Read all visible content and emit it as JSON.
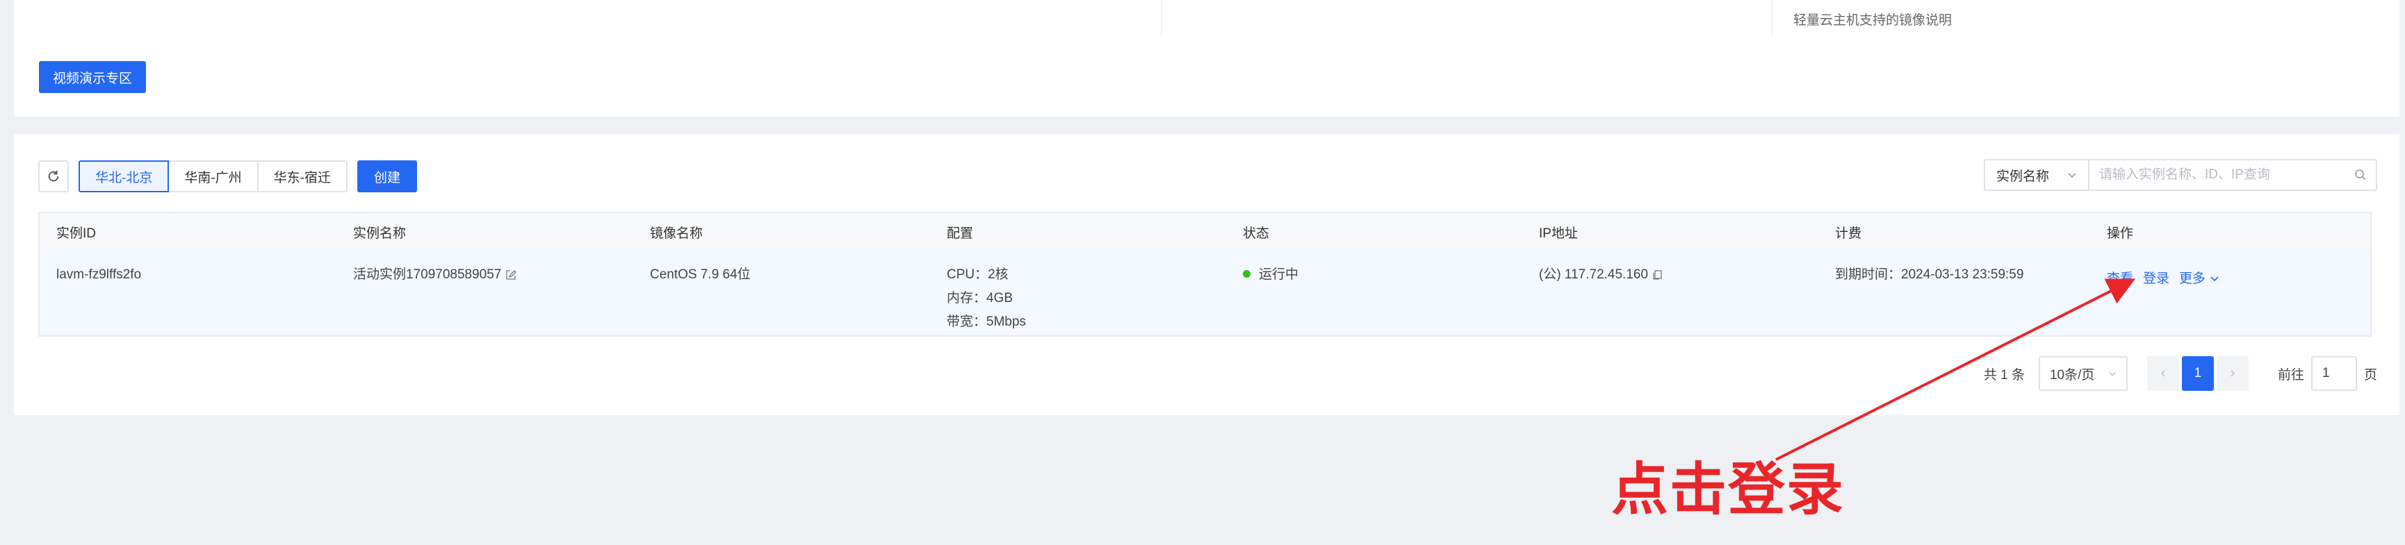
{
  "top_card": {
    "note": "轻量云主机支持的镜像说明",
    "video_button": "视频演示专区"
  },
  "toolbar": {
    "regions": [
      "华北-北京",
      "华南-广州",
      "华东-宿迁"
    ],
    "active_region": "华北-北京",
    "create_label": "创建"
  },
  "search": {
    "select_value": "实例名称",
    "placeholder": "请输入实例名称、ID、IP查询"
  },
  "table": {
    "columns": [
      "实例ID",
      "实例名称",
      "镜像名称",
      "配置",
      "状态",
      "IP地址",
      "计费",
      "操作"
    ],
    "rows": [
      {
        "id": "lavm-fz9lffs2fo",
        "name": "活动实例1709708589057",
        "image": "CentOS 7.9 64位",
        "config": [
          "CPU：2核",
          "内存：4GB",
          "带宽：5Mbps"
        ],
        "status": "运行中",
        "ip": "(公) 117.72.45.160",
        "billing": "到期时间：2024-03-13 23:59:59",
        "actions": {
          "view": "查看",
          "login": "登录",
          "more": "更多"
        }
      }
    ]
  },
  "pagination": {
    "total": "共 1 条",
    "page_size": "10条/页",
    "current_page": "1",
    "goto_label": "前往",
    "goto_value": "1",
    "page_suffix": "页"
  },
  "annotation": {
    "text": "点击登录",
    "color": "#e8262a"
  },
  "colors": {
    "primary": "#2468f2",
    "status_running": "#30bf13"
  }
}
